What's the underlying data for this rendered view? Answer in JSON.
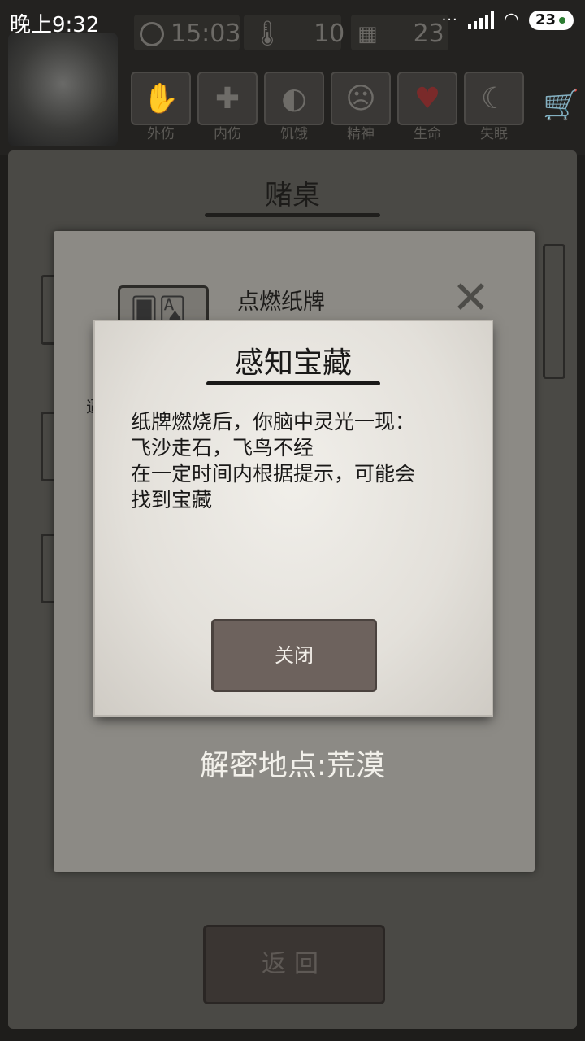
{
  "status_bar": {
    "time": "晚上9:32",
    "battery": "23"
  },
  "hud": {
    "clock": "15:03",
    "temperature": "10",
    "day": "23",
    "status_icons": [
      {
        "label": "外伤",
        "icon": "hand-icon"
      },
      {
        "label": "内伤",
        "icon": "cross-icon"
      },
      {
        "label": "饥饿",
        "icon": "stomach-icon"
      },
      {
        "label": "精神",
        "icon": "head-icon"
      },
      {
        "label": "生命",
        "icon": "heart-icon"
      },
      {
        "label": "失眠",
        "icon": "moon-icon"
      }
    ]
  },
  "panel": {
    "title": "赌桌",
    "item_title": "点燃纸牌",
    "left_text": "逼",
    "hint": "解密地点:荒漠",
    "back_button": "返回"
  },
  "dialog": {
    "title": "感知宝藏",
    "body_lines": [
      "纸牌燃烧后，你脑中灵光一现：",
      "飞沙走石，飞鸟不经",
      "在一定时间内根据提示，可能会",
      "找到宝藏"
    ],
    "close_button": "关闭"
  }
}
